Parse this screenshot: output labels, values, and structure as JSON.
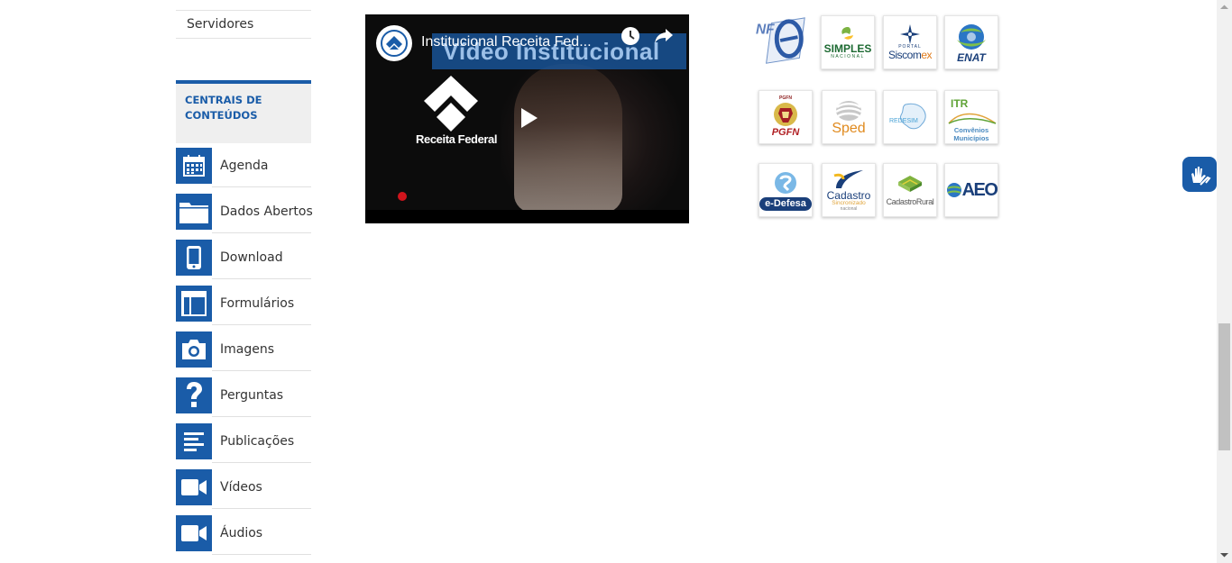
{
  "sidebar": {
    "top_link": "Servidores",
    "section_title": "CENTRAIS DE CONTEÚDOS",
    "items": [
      {
        "label": "Agenda",
        "icon": "calendar-icon"
      },
      {
        "label": "Dados Abertos",
        "icon": "folder-icon"
      },
      {
        "label": "Download",
        "icon": "mobile-icon"
      },
      {
        "label": "Formulários",
        "icon": "form-icon"
      },
      {
        "label": "Imagens",
        "icon": "camera-icon"
      },
      {
        "label": "Perguntas",
        "icon": "question-icon"
      },
      {
        "label": "Publicações",
        "icon": "text-lines-icon"
      },
      {
        "label": "Vídeos",
        "icon": "video-camera-icon"
      },
      {
        "label": "Áudios",
        "icon": "video-camera-icon"
      }
    ]
  },
  "video": {
    "title": "Institucional Receita Fed...",
    "banner_text": "Vídeo Institucional",
    "brand_text": "Receita Federal"
  },
  "logos": {
    "nfe": "NF-e",
    "simples": {
      "line1": "SIMPLES",
      "line2": "NACIONAL"
    },
    "siscomex": {
      "line1": "PORTAL",
      "line2a": "Siscom",
      "line2b": "ex"
    },
    "enat": "ENAT",
    "pgfn": {
      "top": "PGFN",
      "bottom": "PGFN"
    },
    "sped": "Sped",
    "redesim": "REDESIM",
    "itr": {
      "title": "ITR",
      "line1": "Convênios",
      "line2": "Municípios"
    },
    "edefesa": "e-Defesa",
    "cadastro": {
      "line1": "Cadastro",
      "line2": "Sincronizado",
      "line3": "nacional"
    },
    "cadastro_rural": "CadastroRural",
    "aeo": "AEO"
  },
  "colors": {
    "brand_blue": "#1a5ca8",
    "youtube_red": "#d0141c"
  }
}
